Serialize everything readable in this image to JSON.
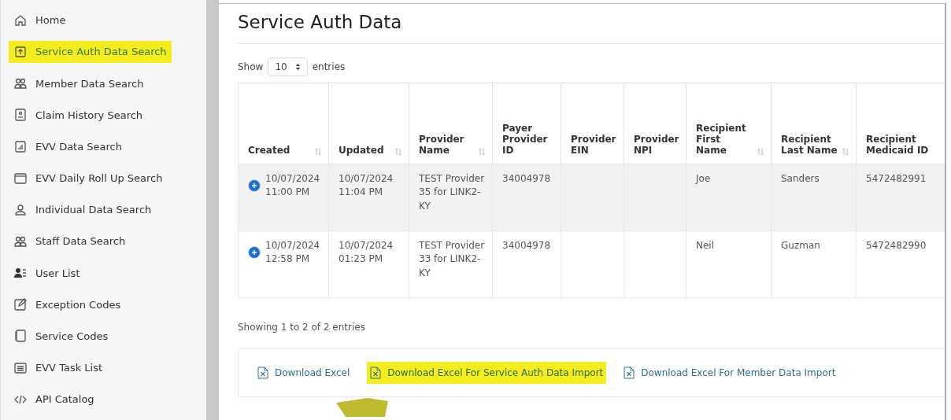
{
  "sidebar": {
    "items": [
      {
        "label": "Home",
        "selected": false
      },
      {
        "label": "Service Auth Data Search",
        "selected": true
      },
      {
        "label": "Member Data Search",
        "selected": false
      },
      {
        "label": "Claim History Search",
        "selected": false
      },
      {
        "label": "EVV Data Search",
        "selected": false
      },
      {
        "label": "EVV Daily Roll Up Search",
        "selected": false
      },
      {
        "label": "Individual Data Search",
        "selected": false
      },
      {
        "label": "Staff Data Search",
        "selected": false
      },
      {
        "label": "User List",
        "selected": false
      },
      {
        "label": "Exception Codes",
        "selected": false
      },
      {
        "label": "Service Codes",
        "selected": false
      },
      {
        "label": "EVV Task List",
        "selected": false
      },
      {
        "label": "API Catalog",
        "selected": false
      }
    ]
  },
  "page": {
    "title": "Service Auth Data"
  },
  "length_menu": {
    "prefix": "Show",
    "value": "10",
    "suffix": "entries"
  },
  "table": {
    "columns": [
      {
        "label": "Created",
        "sortable": true
      },
      {
        "label": "Updated",
        "sortable": true
      },
      {
        "label": "Provider Name",
        "sortable": true
      },
      {
        "label": "Payer Provider ID",
        "sortable": false
      },
      {
        "label": "Provider EIN",
        "sortable": false
      },
      {
        "label": "Provider NPI",
        "sortable": false
      },
      {
        "label": "Recipient First Name",
        "sortable": true
      },
      {
        "label": "Recipient Last Name",
        "sortable": true
      },
      {
        "label": "Recipient Medicaid ID",
        "sortable": false
      }
    ],
    "rows": [
      {
        "cells": [
          "10/07/2024 11:00 PM",
          "10/07/2024 11:04 PM",
          "TEST Provider 35 for LINK2-KY",
          "34004978",
          "",
          "",
          "Joe",
          "Sanders",
          "5472482991"
        ]
      },
      {
        "cells": [
          "10/07/2024 12:58 PM",
          "10/07/2024 01:23 PM",
          "TEST Provider 33 for LINK2-KY",
          "34004978",
          "",
          "",
          "Neil",
          "Guzman",
          "5472482990"
        ]
      }
    ]
  },
  "info": "Showing 1 to 2 of 2 entries",
  "downloads": [
    {
      "label": "Download Excel",
      "highlighted": false
    },
    {
      "label": "Download Excel For Service Auth Data Import",
      "highlighted": true
    },
    {
      "label": "Download Excel For Member Data Import",
      "highlighted": false
    }
  ]
}
